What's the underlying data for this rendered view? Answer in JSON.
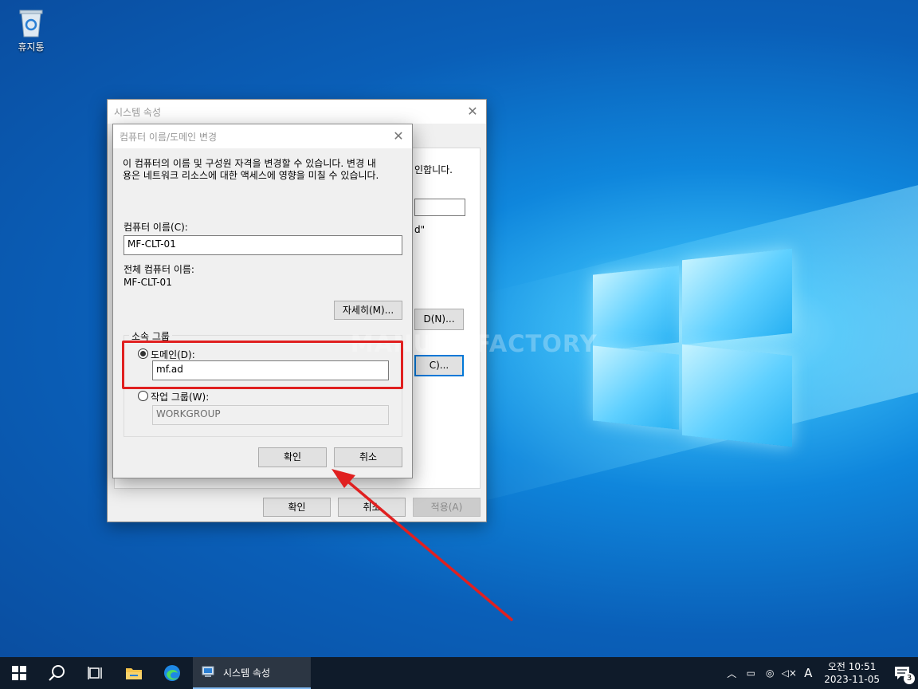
{
  "desktop": {
    "recycle_bin_label": "휴지통",
    "watermark": "MANUAL FACTORY"
  },
  "system_properties": {
    "title": "시스템 속성",
    "fragment_1": "인합니다.",
    "fragment_2": "d\"",
    "fragment_btn_1": "D(N)...",
    "fragment_btn_2": "C)...",
    "ok_label": "확인",
    "cancel_label": "취소",
    "apply_label": "적용(A)"
  },
  "dialog": {
    "title": "컴퓨터 이름/도메인 변경",
    "description_line1": "이 컴퓨터의 이름 및 구성원 자격을 변경할 수 있습니다. 변경 내",
    "description_line2": "용은 네트워크 리소스에 대한 액세스에 영향을 미칠 수 있습니다.",
    "computer_name_label": "컴퓨터 이름(C):",
    "computer_name_value": "MF-CLT-01",
    "full_name_label": "전체 컴퓨터 이름:",
    "full_name_value": "MF-CLT-01",
    "more_button": "자세히(M)...",
    "member_of_label": "소속 그룹",
    "domain_radio_label": "도메인(D):",
    "domain_value": "mf.ad",
    "workgroup_radio_label": "작업 그룹(W):",
    "workgroup_value": "WORKGROUP",
    "domain_selected": true,
    "ok_label": "확인",
    "cancel_label": "취소"
  },
  "taskbar": {
    "active_app_label": "시스템 속성",
    "ime_label": "A",
    "clock_time": "오전 10:51",
    "clock_date": "2023-11-05",
    "notification_count": "3"
  },
  "colors": {
    "highlight": "#e02020",
    "accent": "#0078d7",
    "taskbar": "#0f1b2a"
  }
}
